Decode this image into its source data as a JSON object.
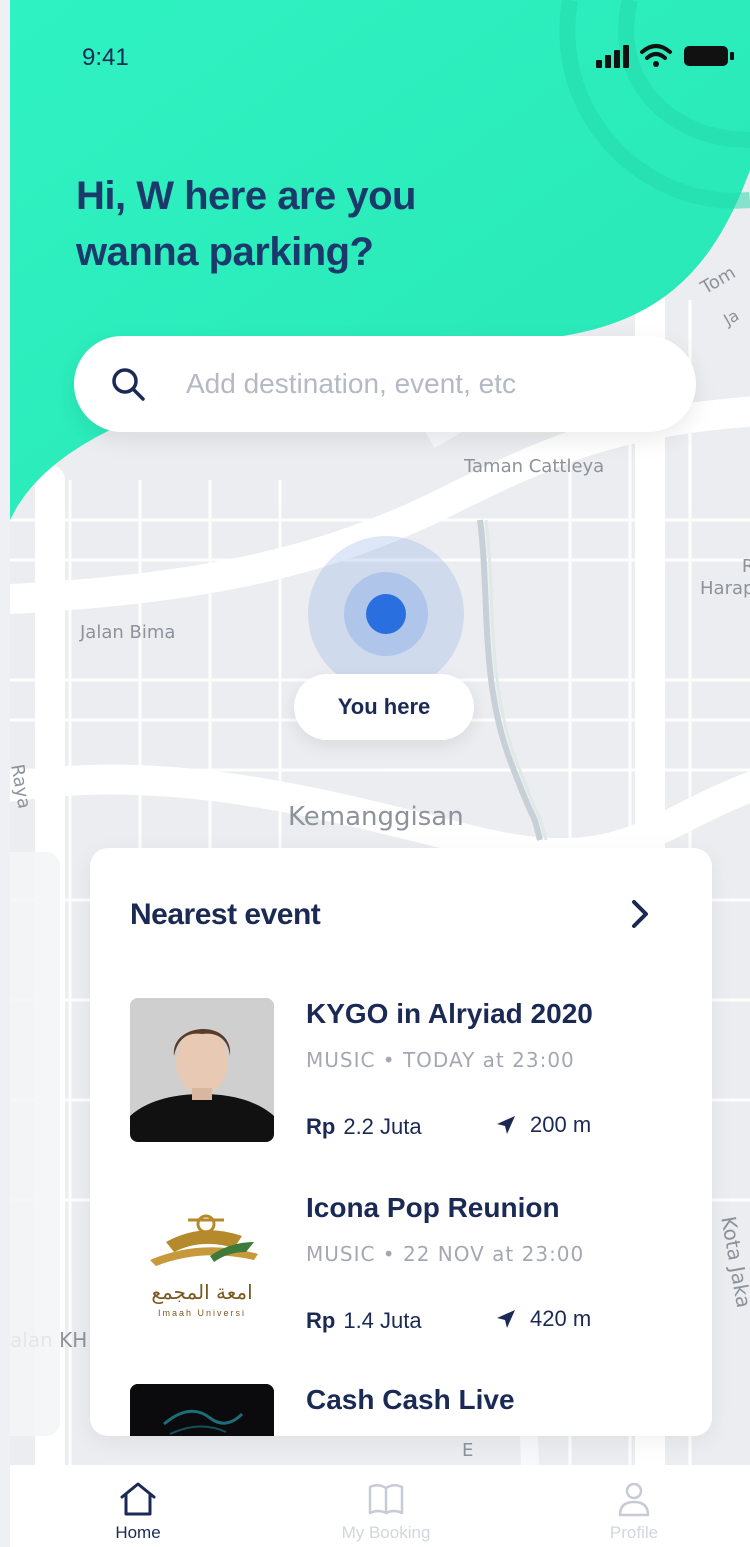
{
  "status_bar": {
    "time": "9:41"
  },
  "header": {
    "greeting_line1": "Hi, W here are you",
    "greeting_line2": "wanna parking?"
  },
  "search": {
    "placeholder": "Add destination, event, etc"
  },
  "map": {
    "labels": {
      "taman_cattleya": "Taman Cattleya",
      "jalan_bima": "Jalan Bima",
      "kemanggisan": "Kemanggisan",
      "raya": "Raya",
      "harap": "R\nHarap",
      "jalan_kh": "alan KH",
      "kota_jakarta": "Kota Jaka",
      "tom": "Tom",
      "ja": "Ja",
      "e": "E"
    },
    "you_here": "You here"
  },
  "nearest_event": {
    "title": "Nearest event",
    "events": [
      {
        "title": "KYGO in Alryiad 2020",
        "meta": "MUSIC • TODAY at 23:00",
        "currency": "Rp",
        "price": "2.2 Juta",
        "distance": "200 m",
        "thumb": "portrait"
      },
      {
        "title": "Icona Pop Reunion",
        "meta": "MUSIC • 22 NOV at 23:00",
        "currency": "Rp",
        "price": "1.4 Juta",
        "distance": "420 m",
        "thumb": "logo",
        "logo_text_ar": "امعة المجمع",
        "logo_text_en": "Imaah Universi"
      },
      {
        "title": "Cash Cash Live",
        "thumb": "dark"
      }
    ]
  },
  "nav": {
    "items": [
      {
        "label": "Home",
        "icon": "home-icon",
        "active": true
      },
      {
        "label": "My Booking",
        "icon": "book-icon",
        "active": false
      },
      {
        "label": "Profile",
        "icon": "user-icon",
        "active": false
      }
    ]
  },
  "colors": {
    "header_green": "#2ff0c0",
    "navy": "#1b2a55",
    "accent_blue": "#2a6fe0",
    "muted": "#a3a8b3"
  }
}
